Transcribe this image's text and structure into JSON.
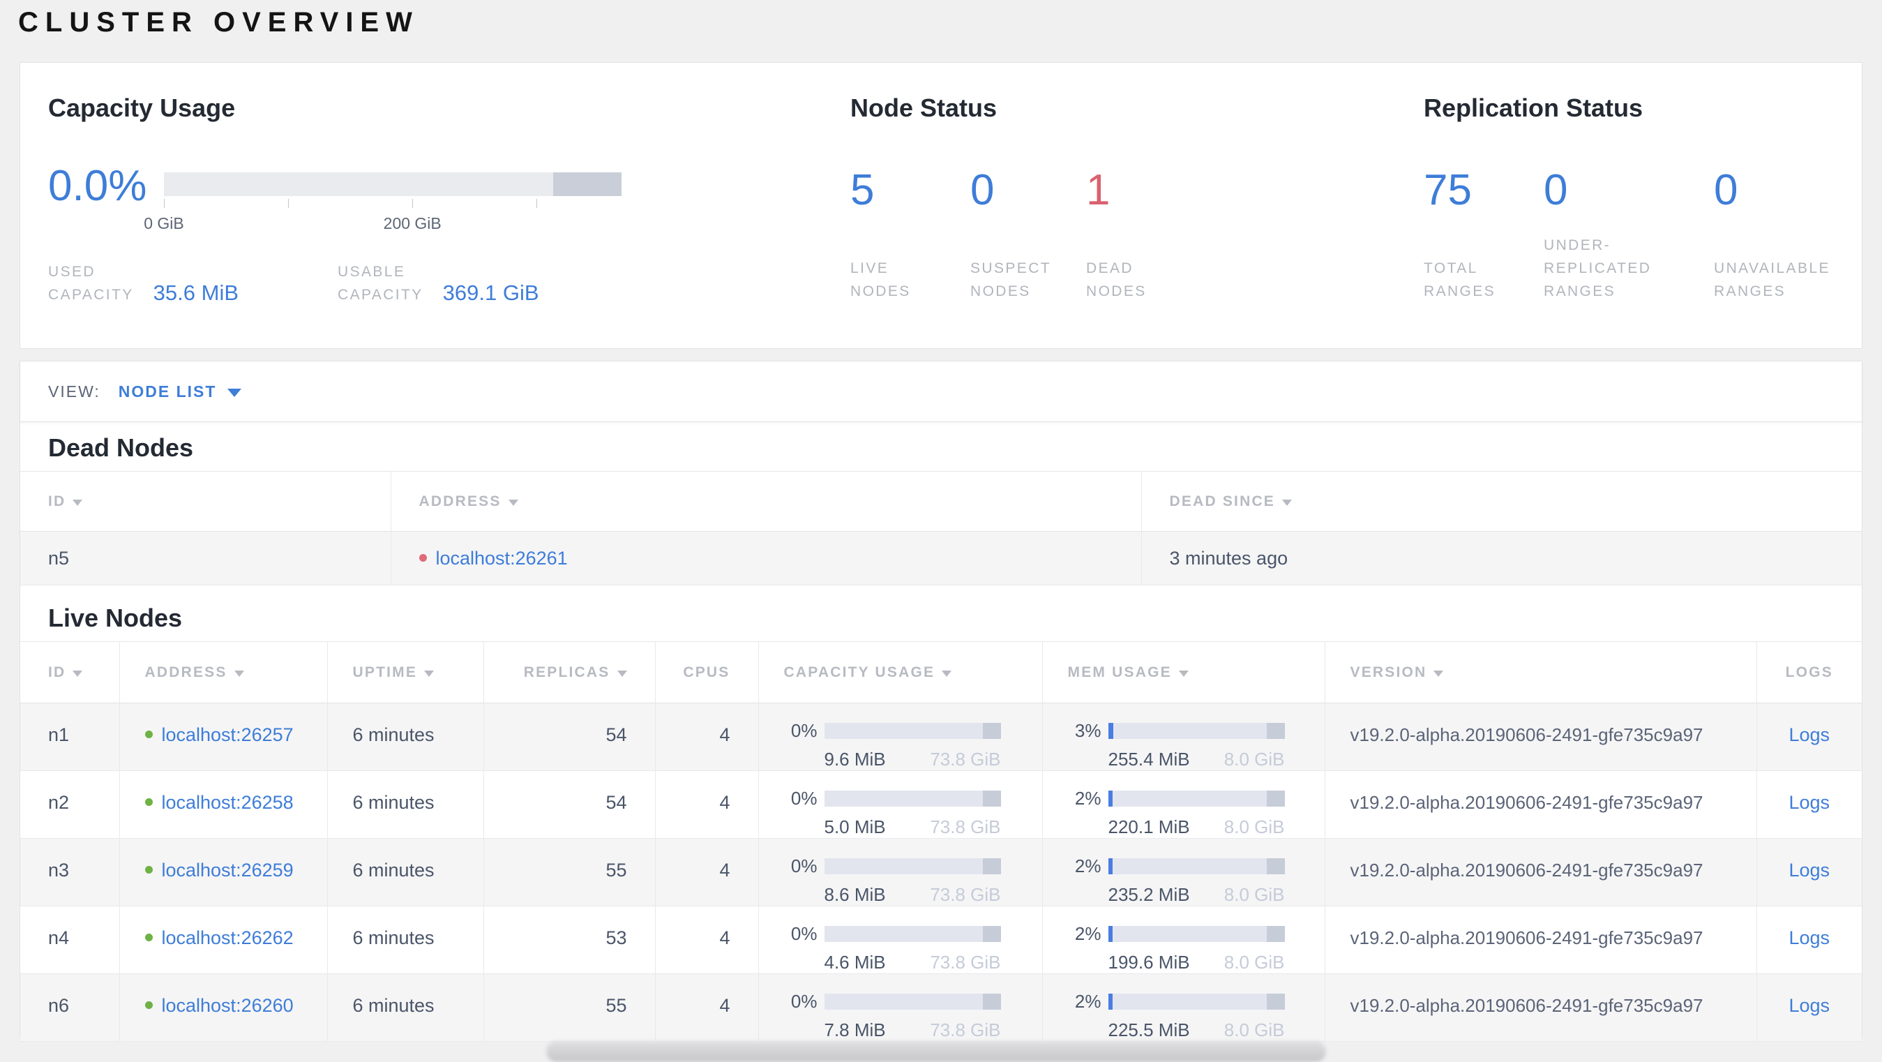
{
  "header": {
    "title": "CLUSTER OVERVIEW"
  },
  "colors": {
    "accent_blue": "#3e7dd8",
    "danger_red": "#d9616f",
    "live_green": "#6db243",
    "dead_dot_red": "#e0697a"
  },
  "summary": {
    "capacity": {
      "heading": "Capacity Usage",
      "percent": "0.0%",
      "bar": {
        "used_pct": 0,
        "reserved_right_pct": 15
      },
      "axis_ticks": [
        {
          "pos_pct": 0,
          "label": "0 GiB"
        },
        {
          "pos_pct": 27.1,
          "label": ""
        },
        {
          "pos_pct": 54.3,
          "label": "200 GiB"
        },
        {
          "pos_pct": 81.4,
          "label": ""
        }
      ],
      "stats": [
        {
          "label_lines": [
            "USED",
            "CAPACITY"
          ],
          "value": "35.6 MiB"
        },
        {
          "label_lines": [
            "USABLE",
            "CAPACITY"
          ],
          "value": "369.1 GiB"
        }
      ]
    },
    "node_status": {
      "heading": "Node Status",
      "stats": [
        {
          "value": "5",
          "label_lines": [
            "LIVE",
            "NODES"
          ],
          "color": "blue"
        },
        {
          "value": "0",
          "label_lines": [
            "SUSPECT",
            "NODES"
          ],
          "color": "blue"
        },
        {
          "value": "1",
          "label_lines": [
            "DEAD",
            "NODES"
          ],
          "color": "red"
        }
      ]
    },
    "replication": {
      "heading": "Replication Status",
      "stats": [
        {
          "value": "75",
          "label_lines": [
            "TOTAL",
            "RANGES"
          ],
          "color": "blue"
        },
        {
          "value": "0",
          "label_lines": [
            "UNDER-",
            "REPLICATED",
            "RANGES"
          ],
          "color": "blue"
        },
        {
          "value": "0",
          "label_lines": [
            "UNAVAILABLE",
            "RANGES"
          ],
          "color": "blue"
        }
      ]
    }
  },
  "view_bar": {
    "label": "VIEW:",
    "selected": "NODE LIST"
  },
  "dead_nodes": {
    "heading": "Dead Nodes",
    "columns": [
      {
        "label": "ID",
        "sort": true
      },
      {
        "label": "ADDRESS",
        "sort": true
      },
      {
        "label": "DEAD SINCE",
        "sort": true
      }
    ],
    "rows": [
      {
        "id": "n5",
        "address": "localhost:26261",
        "status": "dead",
        "dead_since": "3 minutes ago"
      }
    ]
  },
  "live_nodes": {
    "heading": "Live Nodes",
    "columns": [
      {
        "label": "ID",
        "sort": true
      },
      {
        "label": "ADDRESS",
        "sort": true
      },
      {
        "label": "UPTIME",
        "sort": true
      },
      {
        "label": "REPLICAS",
        "sort": true
      },
      {
        "label": "CPUS",
        "sort": false
      },
      {
        "label": "CAPACITY USAGE",
        "sort": true
      },
      {
        "label": "MEM USAGE",
        "sort": true
      },
      {
        "label": "VERSION",
        "sort": true
      },
      {
        "label": "LOGS",
        "sort": false
      }
    ],
    "rows": [
      {
        "id": "n1",
        "address": "localhost:26257",
        "status": "live",
        "uptime": "6 minutes",
        "replicas": "54",
        "cpus": "4",
        "capacity": {
          "pct": "0%",
          "fill_pct": 0,
          "used": "9.6 MiB",
          "total": "73.8 GiB"
        },
        "memory": {
          "pct": "3%",
          "fill_pct": 3,
          "used": "255.4 MiB",
          "total": "8.0 GiB"
        },
        "version": "v19.2.0-alpha.20190606-2491-gfe735c9a97",
        "logs": "Logs"
      },
      {
        "id": "n2",
        "address": "localhost:26258",
        "status": "live",
        "uptime": "6 minutes",
        "replicas": "54",
        "cpus": "4",
        "capacity": {
          "pct": "0%",
          "fill_pct": 0,
          "used": "5.0 MiB",
          "total": "73.8 GiB"
        },
        "memory": {
          "pct": "2%",
          "fill_pct": 2.5,
          "used": "220.1 MiB",
          "total": "8.0 GiB"
        },
        "version": "v19.2.0-alpha.20190606-2491-gfe735c9a97",
        "logs": "Logs"
      },
      {
        "id": "n3",
        "address": "localhost:26259",
        "status": "live",
        "uptime": "6 minutes",
        "replicas": "55",
        "cpus": "4",
        "capacity": {
          "pct": "0%",
          "fill_pct": 0,
          "used": "8.6 MiB",
          "total": "73.8 GiB"
        },
        "memory": {
          "pct": "2%",
          "fill_pct": 2.5,
          "used": "235.2 MiB",
          "total": "8.0 GiB"
        },
        "version": "v19.2.0-alpha.20190606-2491-gfe735c9a97",
        "logs": "Logs"
      },
      {
        "id": "n4",
        "address": "localhost:26262",
        "status": "live",
        "uptime": "6 minutes",
        "replicas": "53",
        "cpus": "4",
        "capacity": {
          "pct": "0%",
          "fill_pct": 0,
          "used": "4.6 MiB",
          "total": "73.8 GiB"
        },
        "memory": {
          "pct": "2%",
          "fill_pct": 2.5,
          "used": "199.6 MiB",
          "total": "8.0 GiB"
        },
        "version": "v19.2.0-alpha.20190606-2491-gfe735c9a97",
        "logs": "Logs"
      },
      {
        "id": "n6",
        "address": "localhost:26260",
        "status": "live",
        "uptime": "6 minutes",
        "replicas": "55",
        "cpus": "4",
        "capacity": {
          "pct": "0%",
          "fill_pct": 0,
          "used": "7.8 MiB",
          "total": "73.8 GiB"
        },
        "memory": {
          "pct": "2%",
          "fill_pct": 2.5,
          "used": "225.5 MiB",
          "total": "8.0 GiB"
        },
        "version": "v19.2.0-alpha.20190606-2491-gfe735c9a97",
        "logs": "Logs"
      }
    ]
  }
}
